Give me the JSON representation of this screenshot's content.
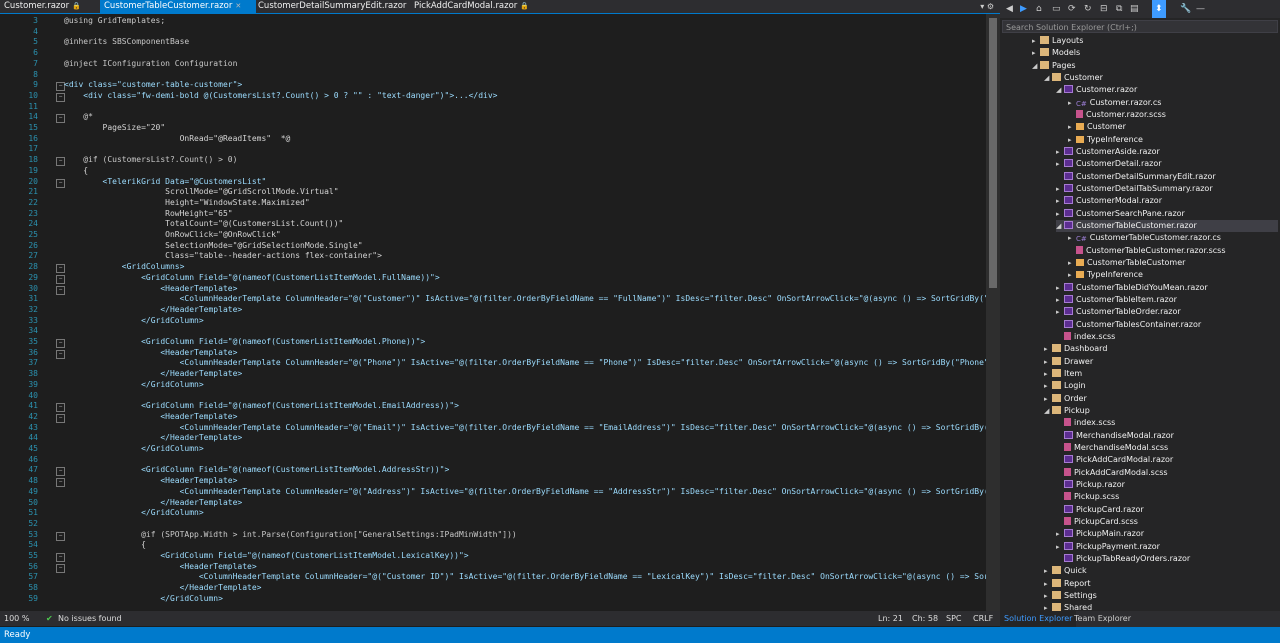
{
  "tabs": [
    {
      "label": "Customer.razor",
      "active": false
    },
    {
      "label": "CustomerTableCustomer.razor",
      "active": true
    },
    {
      "label": "CustomerDetailSummaryEdit.razor",
      "active": false
    },
    {
      "label": "PickAddCardModal.razor",
      "active": false
    }
  ],
  "editor_lines": [
    {
      "n": "3",
      "t": "@using GridTemplates;"
    },
    {
      "n": "4",
      "t": ""
    },
    {
      "n": "5",
      "t": "@inherits SBSComponentBase"
    },
    {
      "n": "6",
      "t": ""
    },
    {
      "n": "7",
      "t": "@inject IConfiguration Configuration"
    },
    {
      "n": "8",
      "t": ""
    },
    {
      "n": "9",
      "t": "<div class=\"customer-table-customer\">"
    },
    {
      "n": "10",
      "t": "    <div class=\"fw-demi-bold @(CustomersList?.Count() > 0 ? \"\" : \"text-danger\")\">...</div>"
    },
    {
      "n": "11",
      "t": ""
    },
    {
      "n": "14",
      "t": "    @*"
    },
    {
      "n": "15",
      "t": "        PageSize=\"20\""
    },
    {
      "n": "16",
      "t": "                        OnRead=\"@ReadItems\"  *@"
    },
    {
      "n": "17",
      "t": ""
    },
    {
      "n": "18",
      "t": "    @if (CustomersList?.Count() > 0)"
    },
    {
      "n": "19",
      "t": "    {"
    },
    {
      "n": "20",
      "t": "        <TelerikGrid Data=\"@CustomersList\""
    },
    {
      "n": "21",
      "t": "                     ScrollMode=\"@GridScrollMode.Virtual\""
    },
    {
      "n": "22",
      "t": "                     Height=\"WindowState.Maximized\""
    },
    {
      "n": "23",
      "t": "                     RowHeight=\"65\""
    },
    {
      "n": "24",
      "t": "                     TotalCount=\"@(CustomersList.Count())\""
    },
    {
      "n": "25",
      "t": "                     OnRowClick=\"@OnRowClick\""
    },
    {
      "n": "26",
      "t": "                     SelectionMode=\"@GridSelectionMode.Single\""
    },
    {
      "n": "27",
      "t": "                     Class=\"table--header-actions flex-container\">"
    },
    {
      "n": "28",
      "t": "            <GridColumns>"
    },
    {
      "n": "29",
      "t": "                <GridColumn Field=\"@(nameof(CustomerListItemModel.FullName))\">"
    },
    {
      "n": "30",
      "t": "                    <HeaderTemplate>"
    },
    {
      "n": "31",
      "t": "                        <ColumnHeaderTemplate ColumnHeader=\"@(\"Customer\")\" IsActive=\"@(filter.OrderByFieldName == \"FullName\")\" IsDesc=\"filter.Desc\" OnSortArrowClick=\"@(async () => SortGridBy(\"F"
    },
    {
      "n": "32",
      "t": "                    </HeaderTemplate>"
    },
    {
      "n": "33",
      "t": "                </GridColumn>"
    },
    {
      "n": "34",
      "t": ""
    },
    {
      "n": "35",
      "t": "                <GridColumn Field=\"@(nameof(CustomerListItemModel.Phone))\">"
    },
    {
      "n": "36",
      "t": "                    <HeaderTemplate>"
    },
    {
      "n": "37",
      "t": "                        <ColumnHeaderTemplate ColumnHeader=\"@(\"Phone\")\" IsActive=\"@(filter.OrderByFieldName == \"Phone\")\" IsDesc=\"filter.Desc\" OnSortArrowClick=\"@(async () => SortGridBy(\"Phone\")"
    },
    {
      "n": "38",
      "t": "                    </HeaderTemplate>"
    },
    {
      "n": "39",
      "t": "                </GridColumn>"
    },
    {
      "n": "40",
      "t": ""
    },
    {
      "n": "41",
      "t": "                <GridColumn Field=\"@(nameof(CustomerListItemModel.EmailAddress))\">"
    },
    {
      "n": "42",
      "t": "                    <HeaderTemplate>"
    },
    {
      "n": "43",
      "t": "                        <ColumnHeaderTemplate ColumnHeader=\"@(\"Email\")\" IsActive=\"@(filter.OrderByFieldName == \"EmailAddress\")\" IsDesc=\"filter.Desc\" OnSortArrowClick=\"@(async () => SortGridBy(\""
    },
    {
      "n": "44",
      "t": "                    </HeaderTemplate>"
    },
    {
      "n": "45",
      "t": "                </GridColumn>"
    },
    {
      "n": "46",
      "t": ""
    },
    {
      "n": "47",
      "t": "                <GridColumn Field=\"@(nameof(CustomerListItemModel.AddressStr))\">"
    },
    {
      "n": "48",
      "t": "                    <HeaderTemplate>"
    },
    {
      "n": "49",
      "t": "                        <ColumnHeaderTemplate ColumnHeader=\"@(\"Address\")\" IsActive=\"@(filter.OrderByFieldName == \"AddressStr\")\" IsDesc=\"filter.Desc\" OnSortArrowClick=\"@(async () => SortGridBy(\""
    },
    {
      "n": "50",
      "t": "                    </HeaderTemplate>"
    },
    {
      "n": "51",
      "t": "                </GridColumn>"
    },
    {
      "n": "52",
      "t": ""
    },
    {
      "n": "53",
      "t": "                @if (SPOTApp.Width > int.Parse(Configuration[\"GeneralSettings:IPadMinWidth\"]))"
    },
    {
      "n": "54",
      "t": "                {"
    },
    {
      "n": "55",
      "t": "                    <GridColumn Field=\"@(nameof(CustomerListItemModel.LexicalKey))\">"
    },
    {
      "n": "56",
      "t": "                        <HeaderTemplate>"
    },
    {
      "n": "57",
      "t": "                            <ColumnHeaderTemplate ColumnHeader=\"@(\"Customer ID\")\" IsActive=\"@(filter.OrderByFieldName == \"LexicalKey\")\" IsDesc=\"filter.Desc\" OnSortArrowClick=\"@(async () => Sort"
    },
    {
      "n": "58",
      "t": "                        </HeaderTemplate>"
    },
    {
      "n": "59",
      "t": "                    </GridColumn>"
    }
  ],
  "status_line": {
    "zoom": "100 %",
    "issues": "No issues found",
    "ln": "Ln: 21",
    "ch": "Ch: 58",
    "spc": "SPC",
    "crlf": "CRLF"
  },
  "statusbar": {
    "text": "Ready"
  },
  "solution_explorer": {
    "search_placeholder": "Search Solution Explorer (Ctrl+;)",
    "items": [
      {
        "label": "Layouts",
        "depth": 1,
        "icon": "folder",
        "exp": "▸"
      },
      {
        "label": "Models",
        "depth": 1,
        "icon": "folder",
        "exp": "▸"
      },
      {
        "label": "Pages",
        "depth": 1,
        "icon": "folder",
        "exp": "◢"
      },
      {
        "label": "Customer",
        "depth": 2,
        "icon": "folder",
        "exp": "◢"
      },
      {
        "label": "Customer.razor",
        "depth": 3,
        "icon": "razor",
        "exp": "◢"
      },
      {
        "label": "Customer.razor.cs",
        "depth": 4,
        "icon": "cs",
        "exp": "▸"
      },
      {
        "label": "Customer.razor.scss",
        "depth": 4,
        "icon": "scss",
        "exp": ""
      },
      {
        "label": "Customer",
        "depth": 4,
        "icon": "cls",
        "exp": "▸"
      },
      {
        "label": "TypeInference",
        "depth": 4,
        "icon": "cls",
        "exp": "▸"
      },
      {
        "label": "CustomerAside.razor",
        "depth": 3,
        "icon": "razor",
        "exp": "▸"
      },
      {
        "label": "CustomerDetail.razor",
        "depth": 3,
        "icon": "razor",
        "exp": "▸"
      },
      {
        "label": "CustomerDetailSummaryEdit.razor",
        "depth": 3,
        "icon": "razor",
        "exp": ""
      },
      {
        "label": "CustomerDetailTabSummary.razor",
        "depth": 3,
        "icon": "razor",
        "exp": "▸"
      },
      {
        "label": "CustomerModal.razor",
        "depth": 3,
        "icon": "razor",
        "exp": "▸"
      },
      {
        "label": "CustomerSearchPane.razor",
        "depth": 3,
        "icon": "razor",
        "exp": "▸"
      },
      {
        "label": "CustomerTableCustomer.razor",
        "depth": 3,
        "icon": "razor",
        "exp": "◢",
        "selected": true
      },
      {
        "label": "CustomerTableCustomer.razor.cs",
        "depth": 4,
        "icon": "cs",
        "exp": "▸"
      },
      {
        "label": "CustomerTableCustomer.razor.scss",
        "depth": 4,
        "icon": "scss",
        "exp": ""
      },
      {
        "label": "CustomerTableCustomer",
        "depth": 4,
        "icon": "cls",
        "exp": "▸"
      },
      {
        "label": "TypeInference",
        "depth": 4,
        "icon": "cls",
        "exp": "▸"
      },
      {
        "label": "CustomerTableDidYouMean.razor",
        "depth": 3,
        "icon": "razor",
        "exp": "▸"
      },
      {
        "label": "CustomerTableItem.razor",
        "depth": 3,
        "icon": "razor",
        "exp": "▸"
      },
      {
        "label": "CustomerTableOrder.razor",
        "depth": 3,
        "icon": "razor",
        "exp": "▸"
      },
      {
        "label": "CustomerTablesContainer.razor",
        "depth": 3,
        "icon": "razor",
        "exp": ""
      },
      {
        "label": "index.scss",
        "depth": 3,
        "icon": "scss",
        "exp": ""
      },
      {
        "label": "Dashboard",
        "depth": 2,
        "icon": "folder",
        "exp": "▸"
      },
      {
        "label": "Drawer",
        "depth": 2,
        "icon": "folder",
        "exp": "▸"
      },
      {
        "label": "Item",
        "depth": 2,
        "icon": "folder",
        "exp": "▸"
      },
      {
        "label": "Login",
        "depth": 2,
        "icon": "folder",
        "exp": "▸"
      },
      {
        "label": "Order",
        "depth": 2,
        "icon": "folder",
        "exp": "▸"
      },
      {
        "label": "Pickup",
        "depth": 2,
        "icon": "folder",
        "exp": "◢"
      },
      {
        "label": "index.scss",
        "depth": 3,
        "icon": "scss",
        "exp": ""
      },
      {
        "label": "MerchandiseModal.razor",
        "depth": 3,
        "icon": "razor",
        "exp": ""
      },
      {
        "label": "MerchandiseModal.scss",
        "depth": 3,
        "icon": "scss",
        "exp": ""
      },
      {
        "label": "PickAddCardModal.razor",
        "depth": 3,
        "icon": "razor",
        "exp": ""
      },
      {
        "label": "PickAddCardModal.scss",
        "depth": 3,
        "icon": "scss",
        "exp": ""
      },
      {
        "label": "Pickup.razor",
        "depth": 3,
        "icon": "razor",
        "exp": ""
      },
      {
        "label": "Pickup.scss",
        "depth": 3,
        "icon": "scss",
        "exp": ""
      },
      {
        "label": "PickupCard.razor",
        "depth": 3,
        "icon": "razor",
        "exp": ""
      },
      {
        "label": "PickupCard.scss",
        "depth": 3,
        "icon": "scss",
        "exp": ""
      },
      {
        "label": "PickupMain.razor",
        "depth": 3,
        "icon": "razor",
        "exp": "▸"
      },
      {
        "label": "PickupPayment.razor",
        "depth": 3,
        "icon": "razor",
        "exp": "▸"
      },
      {
        "label": "PickupTabReadyOrders.razor",
        "depth": 3,
        "icon": "razor",
        "exp": ""
      },
      {
        "label": "Quick",
        "depth": 2,
        "icon": "folder",
        "exp": "▸"
      },
      {
        "label": "Report",
        "depth": 2,
        "icon": "folder",
        "exp": "▸"
      },
      {
        "label": "Settings",
        "depth": 2,
        "icon": "folder",
        "exp": "▸"
      },
      {
        "label": "Shared",
        "depth": 2,
        "icon": "folder",
        "exp": "▸"
      }
    ],
    "bottom_tabs": [
      "Solution Explorer",
      "Team Explorer"
    ]
  }
}
